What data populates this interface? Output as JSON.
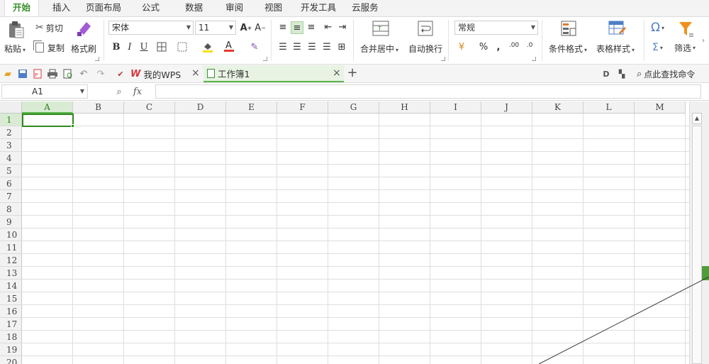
{
  "menu": {
    "tabs": [
      "开始",
      "插入",
      "页面布局",
      "公式",
      "数据",
      "审阅",
      "视图",
      "开发工具",
      "云服务"
    ],
    "active": "开始"
  },
  "ribbon": {
    "clipboard": {
      "paste": "粘贴",
      "cut": "剪切",
      "copy": "复制",
      "format_painter": "格式刷"
    },
    "font": {
      "name": "宋体",
      "size": "11",
      "bold": "B",
      "italic": "I",
      "underline": "U",
      "grow": "A⁺",
      "shrink": "A⁻"
    },
    "align": {
      "merge_center": "合并居中",
      "wrap_text": "自动换行"
    },
    "number": {
      "format": "常规",
      "percent": "%",
      "comma": "،",
      "inc_decimal": ".00",
      "dec_decimal": ".0"
    },
    "styles": {
      "conditional": "条件格式",
      "table_style": "表格样式"
    },
    "edit": {
      "symbol": "Ω",
      "sum": "Σ",
      "filter": "筛选"
    }
  },
  "quickbar": {
    "tabs": [
      {
        "label": "我的WPS",
        "prefix": "W"
      },
      {
        "label": "工作簿1"
      }
    ],
    "add": "+",
    "search": "点此查找命令"
  },
  "formula_bar": {
    "cell_ref": "A1",
    "fx": "fx",
    "value": ""
  },
  "sheet": {
    "columns": [
      "A",
      "B",
      "C",
      "D",
      "E",
      "F",
      "G",
      "H",
      "I",
      "J",
      "K",
      "L",
      "M"
    ],
    "rows": [
      "1",
      "2",
      "3",
      "4",
      "5",
      "6",
      "7",
      "8",
      "9",
      "10",
      "11",
      "12",
      "13",
      "14",
      "15",
      "16",
      "17",
      "18",
      "19",
      "20"
    ],
    "selected_cell": "A1"
  },
  "colors": {
    "accent": "#3a8f2f",
    "selection": "#2f8a1f"
  }
}
